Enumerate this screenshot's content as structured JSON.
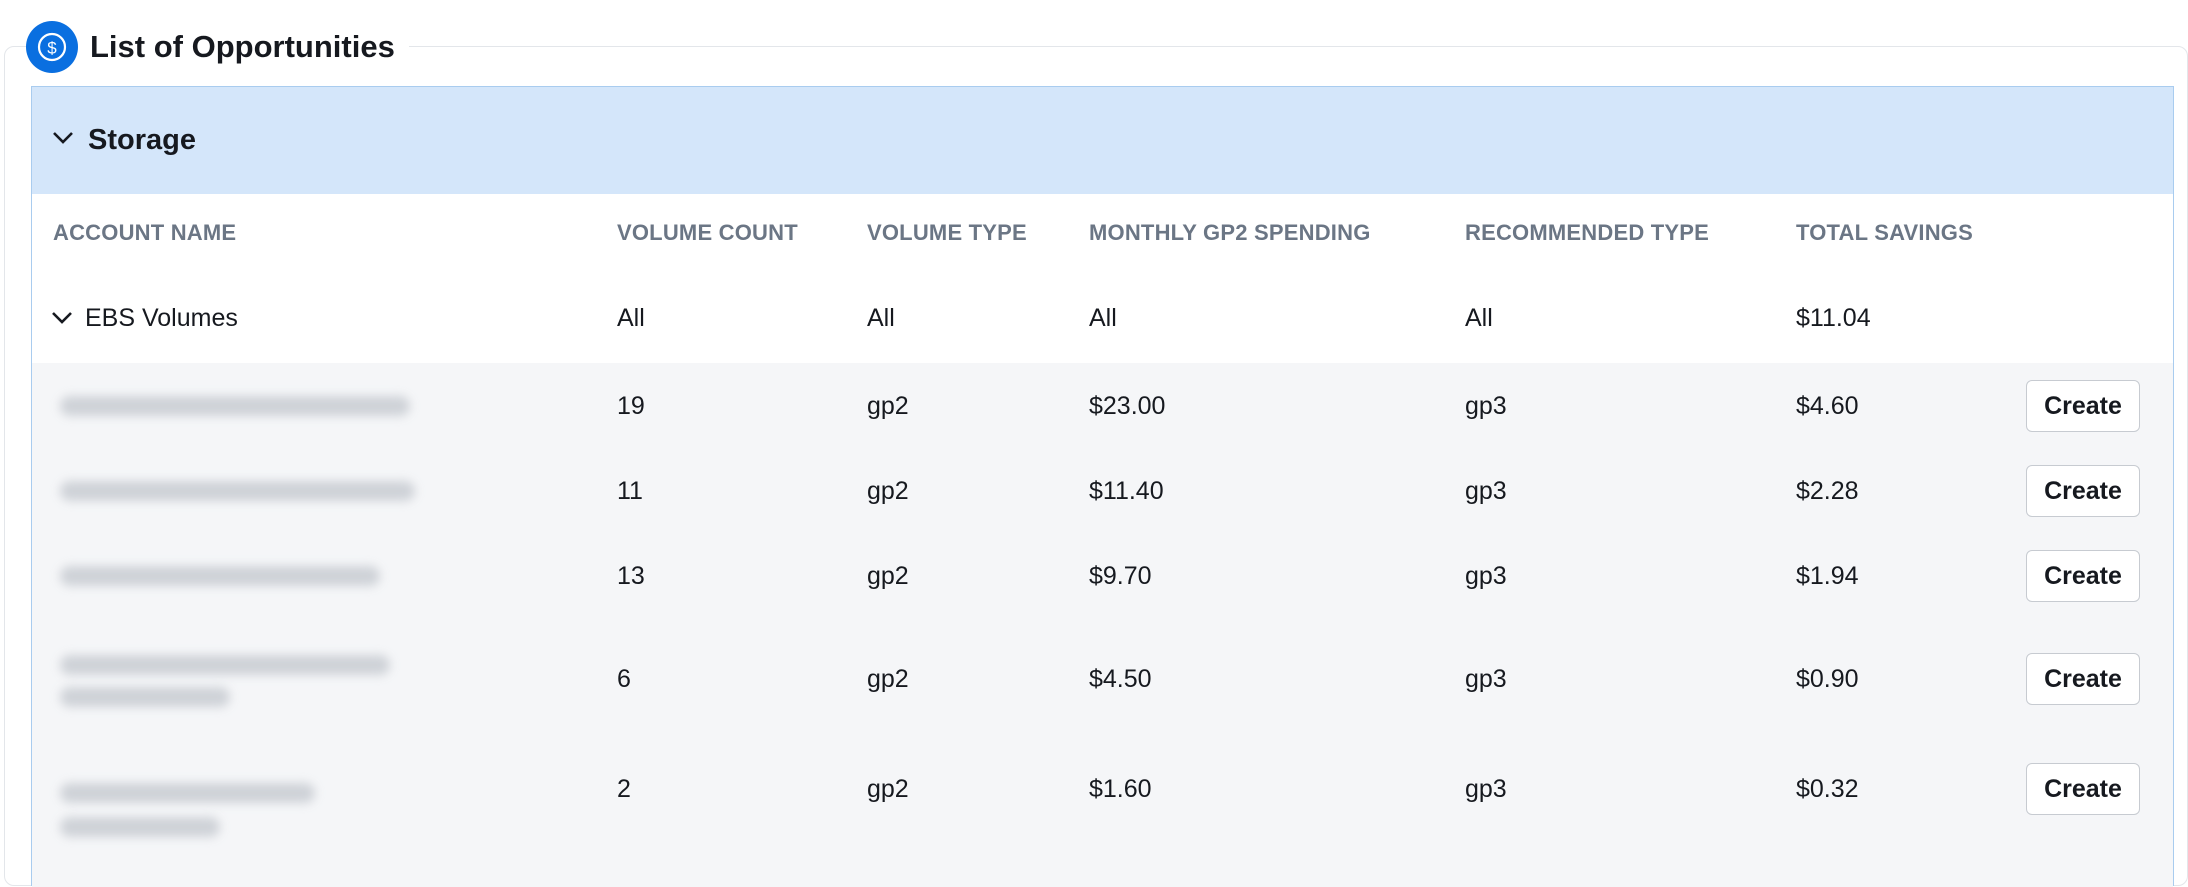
{
  "page": {
    "title": "List of Opportunities",
    "icon": "dollar-circle-icon"
  },
  "section": {
    "title": "Storage",
    "expanded": true
  },
  "table": {
    "columns": [
      "ACCOUNT NAME",
      "VOLUME COUNT",
      "VOLUME TYPE",
      "MONTHLY GP2 SPENDING",
      "RECOMMENDED TYPE",
      "TOTAL SAVINGS"
    ],
    "group": {
      "name": "EBS Volumes",
      "volume_count": "All",
      "volume_type": "All",
      "monthly_spending": "All",
      "recommended_type": "All",
      "total_savings": "$11.04"
    },
    "rows": [
      {
        "volume_count": "19",
        "volume_type": "gp2",
        "monthly_spending": "$23.00",
        "recommended_type": "gp3",
        "total_savings": "$4.60",
        "action": "Create"
      },
      {
        "volume_count": "11",
        "volume_type": "gp2",
        "monthly_spending": "$11.40",
        "recommended_type": "gp3",
        "total_savings": "$2.28",
        "action": "Create"
      },
      {
        "volume_count": "13",
        "volume_type": "gp2",
        "monthly_spending": "$9.70",
        "recommended_type": "gp3",
        "total_savings": "$1.94",
        "action": "Create"
      },
      {
        "volume_count": "6",
        "volume_type": "gp2",
        "monthly_spending": "$4.50",
        "recommended_type": "gp3",
        "total_savings": "$0.90",
        "action": "Create"
      },
      {
        "volume_count": "2",
        "volume_type": "gp2",
        "monthly_spending": "$1.60",
        "recommended_type": "gp3",
        "total_savings": "$0.32",
        "action": "Create"
      }
    ]
  },
  "colors": {
    "accent": "#0a6fe0",
    "section_header_bg": "#d4e6fa",
    "row_bg": "#f5f6f8",
    "header_text": "#6b7685"
  }
}
